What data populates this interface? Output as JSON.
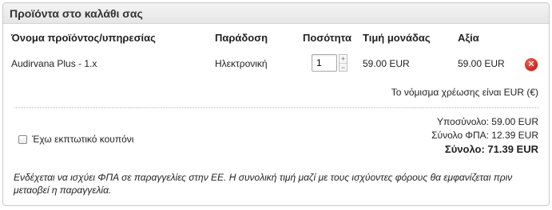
{
  "cart": {
    "title": "Προϊόντα στο καλάθι σας",
    "headers": {
      "product": "Όνομα προϊόντος/υπηρεσίας",
      "delivery": "Παράδοση",
      "quantity": "Ποσότητα",
      "unit_price": "Τιμή μονάδας",
      "value": "Αξία"
    },
    "items": [
      {
        "product": "Audirvana Plus - 1.x",
        "delivery": "Ηλεκτρονική",
        "quantity": "1",
        "unit_price": "59.00 EUR",
        "value": "59.00 EUR",
        "remove_icon": "remove-icon"
      }
    ],
    "currency_note": "Το νόμισμα χρέωσης είναι EUR (€)",
    "stepper": {
      "up": "+",
      "down": "−"
    },
    "remove_glyph": "✕",
    "totals": {
      "subtotal": "Υποσύνολο: 59.00 EUR",
      "vat": "Σύνολο ΦΠΑ: 12.39 EUR",
      "total": "Σύνολο: 71.39 EUR"
    },
    "coupon_label": "Έχω εκπτωτικό κουπόνι",
    "vat_note": "Ενδέχεται να ισχύει ΦΠΑ σε παραγγελίες στην ΕΕ. Η συνολική τιμή μαζί με τους ισχύοντες φόρους θα εμφανίζεται πριν μεταοβεί η παραγγελία.",
    "colors": {
      "header_bg": "#eaeaea",
      "remove_red": "#d0281f",
      "border": "#c9c9c9"
    }
  }
}
